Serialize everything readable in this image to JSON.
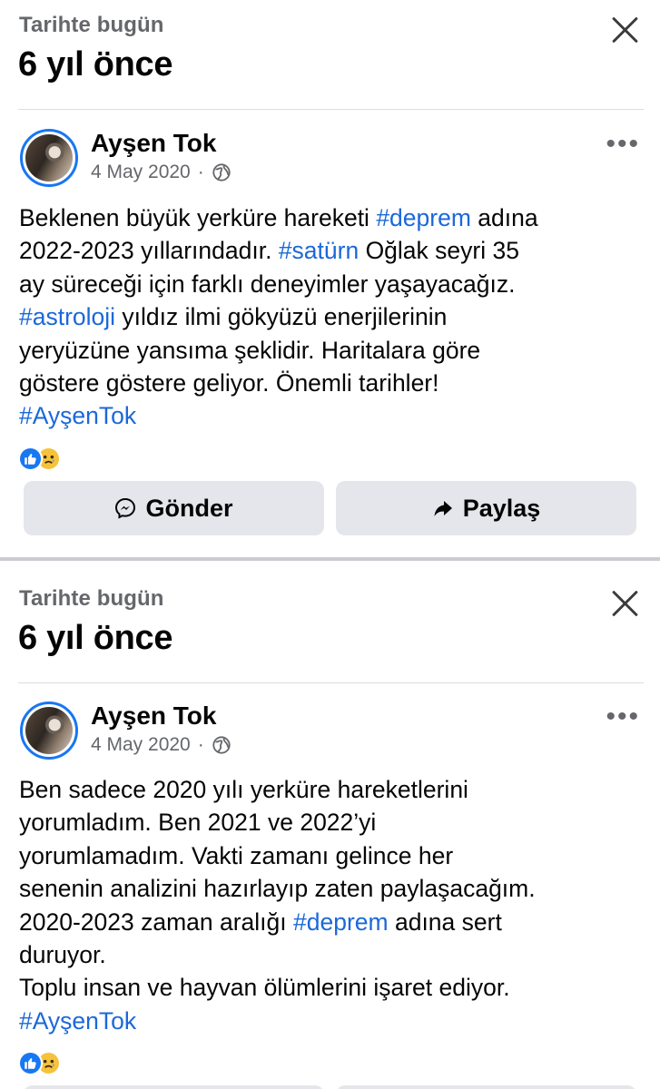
{
  "memories": [
    {
      "kicker": "Tarihte bugün",
      "headline": "6 yıl önce",
      "author": "Ayşen Tok",
      "date": "4 May 2020",
      "dot": "·",
      "more": "•••",
      "text_lines": [
        [
          {
            "t": "Beklenen büyük yerküre hareketi "
          },
          {
            "t": "#deprem",
            "tag": true
          },
          {
            "t": " adına"
          }
        ],
        [
          {
            "t": "2022-2023 yıllarındadır. "
          },
          {
            "t": "#satürn",
            "tag": true
          },
          {
            "t": " Oğlak seyri 35"
          }
        ],
        [
          {
            "t": "ay süreceği için farklı deneyimler yaşayacağız."
          }
        ],
        [
          {
            "t": "#astroloji",
            "tag": true
          },
          {
            "t": " yıldız ilmi gökyüzü enerjilerinin"
          }
        ],
        [
          {
            "t": "yeryüzüne yansıma şeklidir. Haritalara göre"
          }
        ],
        [
          {
            "t": "göstere göstere geliyor. Önemli tarihler!"
          }
        ],
        [
          {
            "t": "#AyşenTok",
            "tag": true
          }
        ]
      ],
      "reactions": [
        "like",
        "sad"
      ],
      "buttons": {
        "send": "Gönder",
        "share": "Paylaş"
      }
    },
    {
      "kicker": "Tarihte bugün",
      "headline": "6 yıl önce",
      "author": "Ayşen Tok",
      "date": "4 May 2020",
      "dot": "·",
      "more": "•••",
      "text_lines": [
        [
          {
            "t": "Ben sadece 2020 yılı yerküre hareketlerini"
          }
        ],
        [
          {
            "t": "yorumladım. Ben 2021 ve 2022’yi"
          }
        ],
        [
          {
            "t": "yorumlamadım. Vakti zamanı gelince her"
          }
        ],
        [
          {
            "t": "senenin analizini hazırlayıp zaten paylaşacağım."
          }
        ],
        [
          {
            "t": "2020-2023 zaman aralığı "
          },
          {
            "t": "#deprem",
            "tag": true
          },
          {
            "t": " adına sert"
          }
        ],
        [
          {
            "t": "duruyor."
          }
        ],
        [
          {
            "t": "Toplu insan ve hayvan ölümlerini işaret ediyor."
          }
        ],
        [
          {
            "t": "#AyşenTok",
            "tag": true
          }
        ]
      ],
      "reactions": [
        "like",
        "sad"
      ]
    }
  ],
  "colors": {
    "hashtag": "#1b68d9",
    "secondary_text": "#65676b",
    "button_bg": "#e4e6eb",
    "like": "#1877f2",
    "sad": "#f7c23b"
  },
  "icons": {
    "close": "close-icon",
    "more": "more-options-icon",
    "audience": "globe-icon",
    "send": "messenger-icon",
    "share": "share-arrow-icon"
  }
}
